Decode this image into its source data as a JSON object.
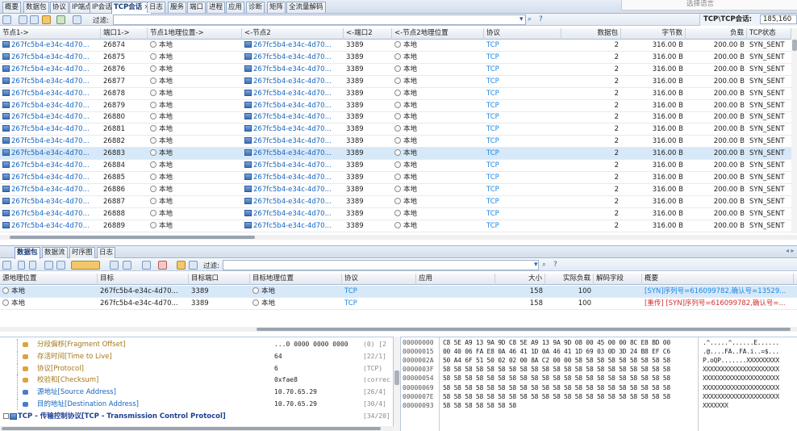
{
  "top_tabs": [
    {
      "label": "概要"
    },
    {
      "label": "数据包"
    },
    {
      "label": "协议"
    },
    {
      "label": "IP端点"
    },
    {
      "label": "IP会话"
    },
    {
      "label": "TCP会话",
      "close": "×",
      "active": true
    },
    {
      "label": "日志"
    },
    {
      "label": "服务"
    },
    {
      "label": "端口"
    },
    {
      "label": "进程"
    },
    {
      "label": "应用"
    },
    {
      "label": "诊断"
    },
    {
      "label": "矩阵"
    },
    {
      "label": "全流量解码"
    }
  ],
  "language_selector": "选择语言",
  "filter_label": "过滤:",
  "summary": {
    "label": "TCP\\TCP会话:",
    "value": "185,160"
  },
  "tcp_columns": [
    "节点1->",
    "端口1->",
    "节点1地理位置->",
    "<-节点2",
    "<-端口2",
    "<-节点2地理位置",
    "协议",
    "数据包",
    "字节数",
    "负载",
    "TCP状态"
  ],
  "tcp_rows": [
    {
      "n1": "267fc5b4-e34c-4d70...",
      "p1": "26874",
      "g1": "本地",
      "n2": "267fc5b4-e34c-4d70...",
      "p2": "3389",
      "g2": "本地",
      "proto": "TCP",
      "pk": "2",
      "bytes": "316.00 B",
      "load": "200.00 B",
      "state": "SYN_SENT"
    },
    {
      "n1": "267fc5b4-e34c-4d70...",
      "p1": "26875",
      "g1": "本地",
      "n2": "267fc5b4-e34c-4d70...",
      "p2": "3389",
      "g2": "本地",
      "proto": "TCP",
      "pk": "2",
      "bytes": "316.00 B",
      "load": "200.00 B",
      "state": "SYN_SENT"
    },
    {
      "n1": "267fc5b4-e34c-4d70...",
      "p1": "26876",
      "g1": "本地",
      "n2": "267fc5b4-e34c-4d70...",
      "p2": "3389",
      "g2": "本地",
      "proto": "TCP",
      "pk": "2",
      "bytes": "316.00 B",
      "load": "200.00 B",
      "state": "SYN_SENT"
    },
    {
      "n1": "267fc5b4-e34c-4d70...",
      "p1": "26877",
      "g1": "本地",
      "n2": "267fc5b4-e34c-4d70...",
      "p2": "3389",
      "g2": "本地",
      "proto": "TCP",
      "pk": "2",
      "bytes": "316.00 B",
      "load": "200.00 B",
      "state": "SYN_SENT"
    },
    {
      "n1": "267fc5b4-e34c-4d70...",
      "p1": "26878",
      "g1": "本地",
      "n2": "267fc5b4-e34c-4d70...",
      "p2": "3389",
      "g2": "本地",
      "proto": "TCP",
      "pk": "2",
      "bytes": "316.00 B",
      "load": "200.00 B",
      "state": "SYN_SENT"
    },
    {
      "n1": "267fc5b4-e34c-4d70...",
      "p1": "26879",
      "g1": "本地",
      "n2": "267fc5b4-e34c-4d70...",
      "p2": "3389",
      "g2": "本地",
      "proto": "TCP",
      "pk": "2",
      "bytes": "316.00 B",
      "load": "200.00 B",
      "state": "SYN_SENT"
    },
    {
      "n1": "267fc5b4-e34c-4d70...",
      "p1": "26880",
      "g1": "本地",
      "n2": "267fc5b4-e34c-4d70...",
      "p2": "3389",
      "g2": "本地",
      "proto": "TCP",
      "pk": "2",
      "bytes": "316.00 B",
      "load": "200.00 B",
      "state": "SYN_SENT"
    },
    {
      "n1": "267fc5b4-e34c-4d70...",
      "p1": "26881",
      "g1": "本地",
      "n2": "267fc5b4-e34c-4d70...",
      "p2": "3389",
      "g2": "本地",
      "proto": "TCP",
      "pk": "2",
      "bytes": "316.00 B",
      "load": "200.00 B",
      "state": "SYN_SENT"
    },
    {
      "n1": "267fc5b4-e34c-4d70...",
      "p1": "26882",
      "g1": "本地",
      "n2": "267fc5b4-e34c-4d70...",
      "p2": "3389",
      "g2": "本地",
      "proto": "TCP",
      "pk": "2",
      "bytes": "316.00 B",
      "load": "200.00 B",
      "state": "SYN_SENT"
    },
    {
      "n1": "267fc5b4-e34c-4d70...",
      "p1": "26883",
      "g1": "本地",
      "n2": "267fc5b4-e34c-4d70...",
      "p2": "3389",
      "g2": "本地",
      "proto": "TCP",
      "pk": "2",
      "bytes": "316.00 B",
      "load": "200.00 B",
      "state": "SYN_SENT",
      "selected": true
    },
    {
      "n1": "267fc5b4-e34c-4d70...",
      "p1": "26884",
      "g1": "本地",
      "n2": "267fc5b4-e34c-4d70...",
      "p2": "3389",
      "g2": "本地",
      "proto": "TCP",
      "pk": "2",
      "bytes": "316.00 B",
      "load": "200.00 B",
      "state": "SYN_SENT"
    },
    {
      "n1": "267fc5b4-e34c-4d70...",
      "p1": "26885",
      "g1": "本地",
      "n2": "267fc5b4-e34c-4d70...",
      "p2": "3389",
      "g2": "本地",
      "proto": "TCP",
      "pk": "2",
      "bytes": "316.00 B",
      "load": "200.00 B",
      "state": "SYN_SENT"
    },
    {
      "n1": "267fc5b4-e34c-4d70...",
      "p1": "26886",
      "g1": "本地",
      "n2": "267fc5b4-e34c-4d70...",
      "p2": "3389",
      "g2": "本地",
      "proto": "TCP",
      "pk": "2",
      "bytes": "316.00 B",
      "load": "200.00 B",
      "state": "SYN_SENT"
    },
    {
      "n1": "267fc5b4-e34c-4d70...",
      "p1": "26887",
      "g1": "本地",
      "n2": "267fc5b4-e34c-4d70...",
      "p2": "3389",
      "g2": "本地",
      "proto": "TCP",
      "pk": "2",
      "bytes": "316.00 B",
      "load": "200.00 B",
      "state": "SYN_SENT"
    },
    {
      "n1": "267fc5b4-e34c-4d70...",
      "p1": "26888",
      "g1": "本地",
      "n2": "267fc5b4-e34c-4d70...",
      "p2": "3389",
      "g2": "本地",
      "proto": "TCP",
      "pk": "2",
      "bytes": "316.00 B",
      "load": "200.00 B",
      "state": "SYN_SENT"
    },
    {
      "n1": "267fc5b4-e34c-4d70...",
      "p1": "26889",
      "g1": "本地",
      "n2": "267fc5b4-e34c-4d70...",
      "p2": "3389",
      "g2": "本地",
      "proto": "TCP",
      "pk": "2",
      "bytes": "316.00 B",
      "load": "200.00 B",
      "state": "SYN_SENT"
    }
  ],
  "bottom_tabs": [
    {
      "label": "数据包",
      "active": true
    },
    {
      "label": "数据流"
    },
    {
      "label": "时序图"
    },
    {
      "label": "日志"
    }
  ],
  "packet_columns": [
    "源地理位置",
    "目标",
    "目标端口",
    "目标地理位置",
    "协议",
    "应用",
    "大小",
    "实际负载",
    "解码字段",
    "概要"
  ],
  "packet_rows": [
    {
      "srcgeo": "本地",
      "dst": "267fc5b4-e34c-4d70...",
      "dport": "3389",
      "dstgeo": "本地",
      "proto": "TCP",
      "app": "",
      "size": "158",
      "payload": "100",
      "decode": "",
      "summary": "[SYN]序列号=616099782,确认号=13529...",
      "summary_color": "#1e88e5",
      "selected": true
    },
    {
      "srcgeo": "本地",
      "dst": "267fc5b4-e34c-4d70...",
      "dport": "3389",
      "dstgeo": "本地",
      "proto": "TCP",
      "app": "",
      "size": "158",
      "payload": "100",
      "decode": "",
      "summary": "[重传] [SYN]序列号=616099782,确认号=...",
      "summary_color": "#d32f2f"
    }
  ],
  "decode_tree": [
    {
      "label": "分段偏移[Fragment Offset]",
      "value": "...0 0000 0000 0000",
      "extra": "(0)  [2",
      "style": "gold",
      "indent": 36
    },
    {
      "label": "存活时间[Time to Live]",
      "value": "64",
      "extra": "[22/1]",
      "style": "gold",
      "indent": 36
    },
    {
      "label": "协议[Protocol]",
      "value": "6",
      "extra": "(TCP)",
      "style": "gold",
      "indent": 36
    },
    {
      "label": "校验和[Checksum]",
      "value": "0xfae8",
      "extra": "(correc",
      "style": "gold",
      "indent": 36
    },
    {
      "label": "源地址[Source Address]",
      "value": "10.70.65.29",
      "extra": "[26/4]",
      "style": "bluelink",
      "indent": 36
    },
    {
      "label": "目的地址[Destination Address]",
      "value": "10.70.65.29",
      "extra": "[30/4]",
      "style": "bluelink",
      "indent": 36
    },
    {
      "label": "TCP - 传输控制协议[TCP - Transmission Control Protocol]",
      "value": "",
      "extra": "[34/20]",
      "style": "blueb",
      "indent": 12
    }
  ],
  "hex_rows": [
    {
      "offset": "00000000",
      "hex": "C8 5E A9 13 9A 9D C8 5E A9 13 9A 9D 08 00 45 00 00 8C E8 BD 00",
      "ascii": ".^.....^......E......"
    },
    {
      "offset": "00000015",
      "hex": "00 40 06 FA E8 0A 46 41 1D 0A 46 41 1D 69 03 0D 3D 24 B8 EF C6",
      "ascii": ".@....FA..FA.i..=$..."
    },
    {
      "offset": "0000002A",
      "hex": "50 A4 6F 51 50 02 02 00 8A C2 00 00 58 58 58 58 58 58 58 58 58",
      "ascii": "P.oQP.......XXXXXXXXX"
    },
    {
      "offset": "0000003F",
      "hex": "58 58 58 58 58 58 58 58 58 58 58 58 58 58 58 58 58 58 58 58 58",
      "ascii": "XXXXXXXXXXXXXXXXXXXXX"
    },
    {
      "offset": "00000054",
      "hex": "58 58 58 58 58 58 58 58 58 58 58 58 58 58 58 58 58 58 58 58 58",
      "ascii": "XXXXXXXXXXXXXXXXXXXXX"
    },
    {
      "offset": "00000069",
      "hex": "58 58 58 58 58 58 58 58 58 58 58 58 58 58 58 58 58 58 58 58 58",
      "ascii": "XXXXXXXXXXXXXXXXXXXXX"
    },
    {
      "offset": "0000007E",
      "hex": "58 58 58 58 58 58 58 58 58 58 58 58 58 58 58 58 58 58 58 58 58",
      "ascii": "XXXXXXXXXXXXXXXXXXXXX"
    },
    {
      "offset": "00000093",
      "hex": "58 58 58 58 58 58 58",
      "ascii": "XXXXXXX"
    }
  ]
}
